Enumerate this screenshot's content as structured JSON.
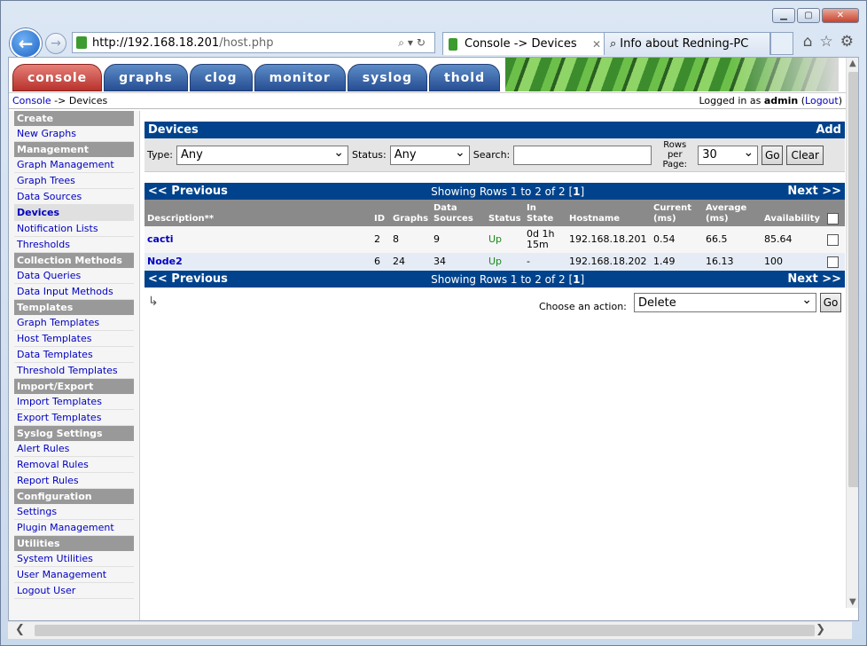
{
  "browser": {
    "url_host": "http://192.168.18.201",
    "url_path": "/host.php",
    "tabs": [
      {
        "label": "Console -> Devices"
      },
      {
        "label": "Info about Redning-PC"
      }
    ]
  },
  "topnav": {
    "tabs": [
      "console",
      "graphs",
      "clog",
      "monitor",
      "syslog",
      "thold"
    ]
  },
  "breadcrumb": {
    "root": "Console",
    "sep": " -> ",
    "current": "Devices"
  },
  "login": {
    "prefix": "Logged in as ",
    "user": "admin",
    "logout": "Logout"
  },
  "sidebar": {
    "sections": [
      {
        "head": "Create",
        "items": [
          "New Graphs"
        ]
      },
      {
        "head": "Management",
        "items": [
          "Graph Management",
          "Graph Trees",
          "Data Sources",
          "Devices",
          "Notification Lists",
          "Thresholds"
        ]
      },
      {
        "head": "Collection Methods",
        "items": [
          "Data Queries",
          "Data Input Methods"
        ]
      },
      {
        "head": "Templates",
        "items": [
          "Graph Templates",
          "Host Templates",
          "Data Templates",
          "Threshold Templates"
        ]
      },
      {
        "head": "Import/Export",
        "items": [
          "Import Templates",
          "Export Templates"
        ]
      },
      {
        "head": "Syslog Settings",
        "items": [
          "Alert Rules",
          "Removal Rules",
          "Report Rules"
        ]
      },
      {
        "head": "Configuration",
        "items": [
          "Settings",
          "Plugin Management"
        ]
      },
      {
        "head": "Utilities",
        "items": [
          "System Utilities",
          "User Management",
          "Logout User"
        ]
      }
    ],
    "active": "Devices"
  },
  "devices": {
    "title": "Devices",
    "add": "Add",
    "filter": {
      "type_label": "Type:",
      "type_value": "Any",
      "status_label": "Status:",
      "status_value": "Any",
      "search_label": "Search:",
      "search_value": "",
      "rows_label": "Rows per Page:",
      "rows_value": "30",
      "go": "Go",
      "clear": "Clear"
    },
    "nav": {
      "prev": "<< Previous",
      "showing_prefix": "Showing Rows 1 to 2 of 2 [",
      "page": "1",
      "showing_suffix": "]",
      "next": "Next >>"
    },
    "columns": [
      "Description**",
      "ID",
      "Graphs",
      "Data Sources",
      "Status",
      "In State",
      "Hostname",
      "Current (ms)",
      "Average (ms)",
      "Availability"
    ],
    "rows": [
      {
        "desc": "cacti",
        "id": "2",
        "graphs": "8",
        "ds": "9",
        "status": "Up",
        "in_state": "0d 1h 15m",
        "host": "192.168.18.201",
        "cur": "0.54",
        "avg": "66.5",
        "avail": "85.64"
      },
      {
        "desc": "Node2",
        "id": "6",
        "graphs": "24",
        "ds": "34",
        "status": "Up",
        "in_state": "-",
        "host": "192.168.18.202",
        "cur": "1.49",
        "avg": "16.13",
        "avail": "100"
      }
    ],
    "action_label": "Choose an action:",
    "action_value": "Delete",
    "action_go": "Go"
  }
}
